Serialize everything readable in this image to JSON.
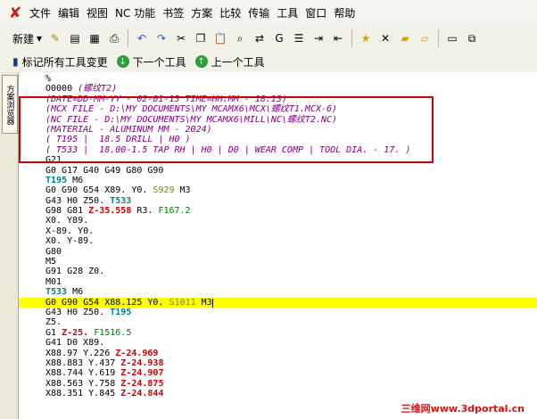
{
  "menubar": [
    "文件",
    "编辑",
    "视图",
    "NC 功能",
    "书签",
    "方案",
    "比较",
    "传输",
    "工具",
    "窗口",
    "帮助"
  ],
  "toolbar": {
    "new_label": "新建"
  },
  "toolbar2": {
    "mark_label": "标记所有工具变更",
    "next_label": "下一个工具",
    "prev_label": "上一个工具"
  },
  "side": {
    "tab_label": "方案浏览器"
  },
  "code_lines": [
    [
      [
        "%",
        ""
      ]
    ],
    [
      [
        "O0000 ",
        ""
      ],
      [
        "(螺纹T2)",
        "c"
      ]
    ],
    [
      [
        "(DATE=DD-MM-YY - 02-01-13 TIME=HH:MM - 18:13)",
        "c"
      ]
    ],
    [
      [
        "(MCX FILE - D:\\MY DOCUMENTS\\MY MCAMX6\\MCX\\螺纹T1.MCX-6)",
        "c"
      ]
    ],
    [
      [
        "(NC FILE - D:\\MY DOCUMENTS\\MY MCAMX6\\MILL\\NC\\螺纹T2.NC)",
        "c"
      ]
    ],
    [
      [
        "(MATERIAL - ALUMINUM MM - 2024)",
        "c"
      ]
    ],
    [
      [
        "( T195 |  18.5 DRILL | H0 )",
        "c"
      ]
    ],
    [
      [
        "( T533 |  18.00-1.5 TAP RH | H0 | D0 | WEAR COMP | TOOL DIA. - 17. )",
        "c"
      ]
    ],
    [
      [
        "G21",
        ""
      ]
    ],
    [
      [
        "G0 G17 G40 G49 G80 G90",
        ""
      ]
    ],
    [
      [
        "T195",
        "t"
      ],
      [
        " M6",
        ""
      ]
    ],
    [
      [
        "G0 G90 G54 X89. Y0. ",
        ""
      ],
      [
        "S929",
        "s"
      ],
      [
        " M3",
        ""
      ]
    ],
    [
      [
        "G43 H0 Z50. ",
        ""
      ],
      [
        "T533",
        "t"
      ]
    ],
    [
      [
        "G98 G81 ",
        ""
      ],
      [
        "Z-35.558",
        "r"
      ],
      [
        " R3. ",
        ""
      ],
      [
        "F167.2",
        "f"
      ]
    ],
    [
      [
        "X0. Y89.",
        ""
      ]
    ],
    [
      [
        "X-89. Y0.",
        ""
      ]
    ],
    [
      [
        "X0. Y-89.",
        ""
      ]
    ],
    [
      [
        "G80",
        ""
      ]
    ],
    [
      [
        "M5",
        ""
      ]
    ],
    [
      [
        "G91 G28 Z0.",
        ""
      ]
    ],
    [
      [
        "M01",
        ""
      ]
    ],
    [
      [
        "T533",
        "t"
      ],
      [
        " M6",
        ""
      ]
    ],
    [
      [
        "G0 G90 G54 X88.125 Y0. ",
        ""
      ],
      [
        "S1011",
        "s"
      ],
      [
        " M3",
        ""
      ]
    ],
    [
      [
        "G43 H0 Z50. ",
        ""
      ],
      [
        "T195",
        "t"
      ]
    ],
    [
      [
        "Z5.",
        ""
      ]
    ],
    [
      [
        "G1 ",
        ""
      ],
      [
        "Z-25.",
        "r"
      ],
      [
        " ",
        ""
      ],
      [
        "F1516.5",
        "f"
      ]
    ],
    [
      [
        "G41 D0 X89.",
        ""
      ]
    ],
    [
      [
        "X88.97 Y.226 ",
        ""
      ],
      [
        "Z-24.969",
        "r"
      ]
    ],
    [
      [
        "X88.883 Y.437 ",
        ""
      ],
      [
        "Z-24.938",
        "r"
      ]
    ],
    [
      [
        "X88.744 Y.619 ",
        ""
      ],
      [
        "Z-24.907",
        "r"
      ]
    ],
    [
      [
        "X88.563 Y.758 ",
        ""
      ],
      [
        "Z-24.875",
        "r"
      ]
    ],
    [
      [
        "X88.351 Y.845 ",
        ""
      ],
      [
        "Z-24.844",
        "r"
      ]
    ]
  ],
  "current_line": 22,
  "watermark": "三维网www.3dportal.cn"
}
